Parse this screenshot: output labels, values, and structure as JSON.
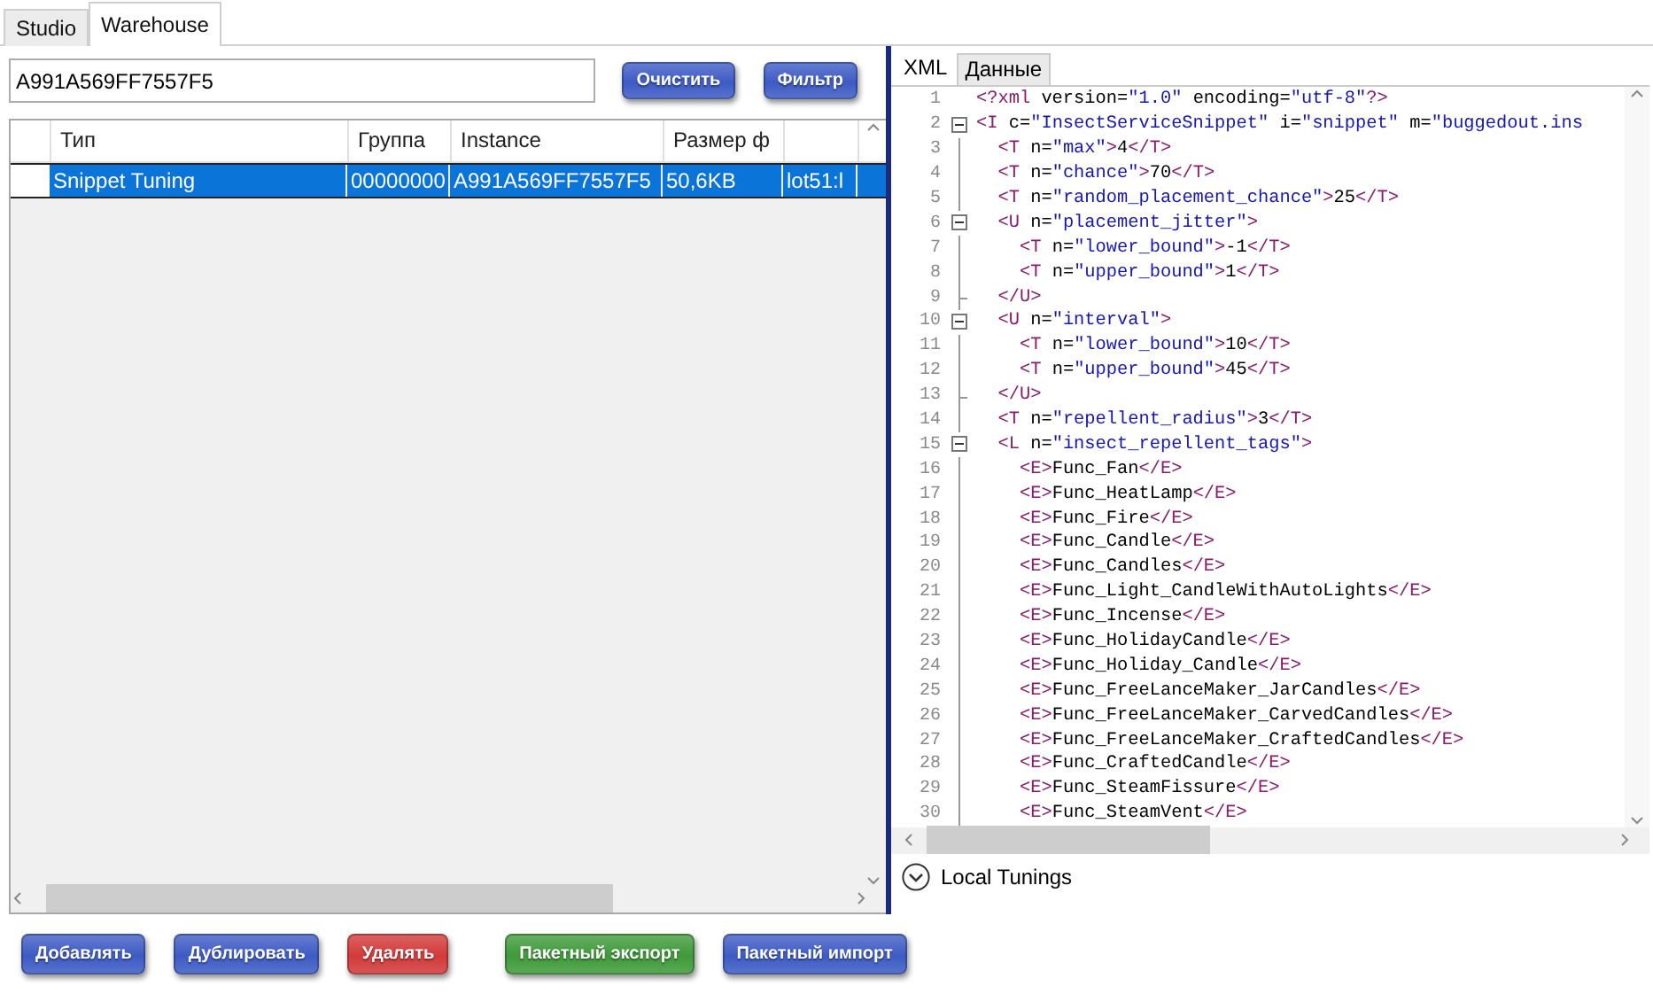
{
  "tabs": [
    {
      "label": "Studio",
      "selected": false
    },
    {
      "label": "Warehouse",
      "selected": true
    }
  ],
  "search": {
    "value": "A991A569FF7557F5"
  },
  "search_buttons": [
    "Очистить",
    "Фильтр"
  ],
  "table": {
    "columns": [
      "Тип",
      "Группа",
      "Instance",
      "Размер ф"
    ],
    "rows": [
      {
        "cells": [
          "Snippet Tuning",
          "00000000",
          "A991A569FF7557F5",
          "50,6KB",
          "lot51:l"
        ],
        "selected": true
      }
    ]
  },
  "editor_tabs": [
    {
      "label": "XML",
      "selected": true
    },
    {
      "label": "Данные",
      "selected": false
    }
  ],
  "xml_lines": [
    {
      "number": "1",
      "text": "<?xml version=\"1.0\" encoding=\"utf-8\"?>"
    },
    {
      "number": "2",
      "text": "<I c=\"InsectServiceSnippet\" i=\"snippet\" m=\"buggedout.ins",
      "collapsible": true
    },
    {
      "number": "3",
      "text": "  <T n=\"max\">4</T>",
      "collapsible": false
    },
    {
      "number": "4",
      "text": "  <T n=\"chance\">70</T>",
      "collapsible": false
    },
    {
      "number": "5",
      "text": "  <T n=\"random_placement_chance\">25</T>",
      "collapsible": false
    },
    {
      "number": "6",
      "text": "  <U n=\"placement_jitter\">",
      "collapsible": true
    },
    {
      "number": "7",
      "text": "    <T n=\"lower_bound\">-1</T>",
      "collapsible": false
    },
    {
      "number": "8",
      "text": "    <T n=\"upper_bound\">1</T>",
      "collapsible": false
    },
    {
      "number": "9",
      "text": "  </U>",
      "collapsible": false
    },
    {
      "number": "10",
      "text": "  <U n=\"interval\">",
      "collapsible": true
    },
    {
      "number": "11",
      "text": "    <T n=\"lower_bound\">10</T>",
      "collapsible": false
    },
    {
      "number": "12",
      "text": "    <T n=\"upper_bound\">45</T>",
      "collapsible": false
    },
    {
      "number": "13",
      "text": "  </U>",
      "collapsible": false
    },
    {
      "number": "14",
      "text": "  <T n=\"repellent_radius\">3</T>",
      "collapsible": false
    },
    {
      "number": "15",
      "text": "  <L n=\"insect_repellent_tags\">",
      "collapsible": true
    },
    {
      "number": "16",
      "text": "    <E>Func_Fan</E>",
      "collapsible": false
    },
    {
      "number": "17",
      "text": "    <E>Func_HeatLamp</E>",
      "collapsible": false
    },
    {
      "number": "18",
      "text": "    <E>Func_Fire</E>",
      "collapsible": false
    },
    {
      "number": "19",
      "text": "    <E>Func_Candle</E>",
      "collapsible": false
    },
    {
      "number": "20",
      "text": "    <E>Func_Candles</E>",
      "collapsible": false
    },
    {
      "number": "21",
      "text": "    <E>Func_Light_CandleWithAutoLights</E>",
      "collapsible": false
    },
    {
      "number": "22",
      "text": "    <E>Func_Incense</E>",
      "collapsible": false
    },
    {
      "number": "23",
      "text": "    <E>Func_HolidayCandle</E>",
      "collapsible": false
    },
    {
      "number": "24",
      "text": "    <E>Func_Holiday_Candle</E>",
      "collapsible": false
    },
    {
      "number": "25",
      "text": "    <E>Func_FreeLanceMaker_JarCandles</E>",
      "collapsible": false
    },
    {
      "number": "26",
      "text": "    <E>Func_FreeLanceMaker_CarvedCandles</E>",
      "collapsible": false
    },
    {
      "number": "27",
      "text": "    <E>Func_FreeLanceMaker_CraftedCandles</E>",
      "collapsible": false
    },
    {
      "number": "28",
      "text": "    <E>Func_CraftedCandle</E>",
      "collapsible": false
    },
    {
      "number": "29",
      "text": "    <E>Func_SteamFissure</E>",
      "collapsible": false
    },
    {
      "number": "30",
      "text": "    <E>Func_SteamVent</E>",
      "collapsible": false
    }
  ],
  "expander": {
    "label": "Local Tunings",
    "expanded": false
  },
  "actions": [
    {
      "label": "Добавлять",
      "color": "#3d5bc4"
    },
    {
      "label": "Дублировать",
      "color": "#3d5bc4"
    },
    {
      "label": "Удалять",
      "color": "#d23a3a"
    },
    {
      "label": "Пакетный экспорт",
      "color": "#3f9a3a"
    },
    {
      "label": "Пакетный импорт",
      "color": "#3d5bc4"
    }
  ]
}
